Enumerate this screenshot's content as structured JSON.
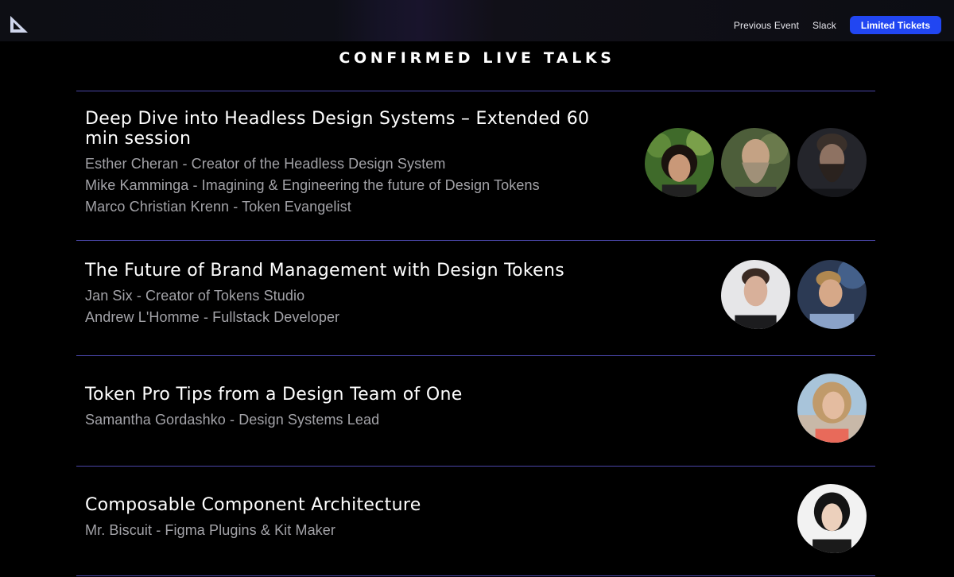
{
  "nav": {
    "logo_icon": "triangle-logo-icon",
    "links": [
      "Previous Event",
      "Slack"
    ],
    "cta_label": "Limited Tickets",
    "cta_color": "#2146f2"
  },
  "section_title": "CONFIRMED LIVE TALKS",
  "talks": [
    {
      "title": "Deep Dive into Headless Design Systems – Extended 60 min session",
      "speakers": [
        "Esther Cheran - Creator of the Headless Design System",
        "Mike Kamminga - Imagining & Engineering the future of Design Tokens",
        "Marco Christian Krenn - Token Evangelist"
      ]
    },
    {
      "title": "The Future of Brand Management with Design Tokens",
      "speakers": [
        "Jan Six - Creator of Tokens Studio",
        "Andrew L'Homme - Fullstack Developer"
      ]
    },
    {
      "title": "Token Pro Tips from a Design Team of One",
      "speakers": [
        "Samantha Gordashko - Design Systems Lead"
      ]
    },
    {
      "title": "Composable Component Architecture",
      "speakers": [
        "Mr. Biscuit - Figma Plugins & Kit Maker"
      ]
    }
  ],
  "colors": {
    "divider": "#4a46a8",
    "speaker_text": "#a3a3a8",
    "background": "#000000"
  }
}
